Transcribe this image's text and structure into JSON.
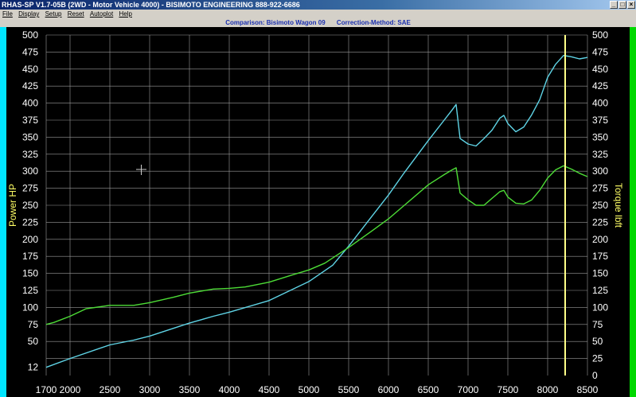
{
  "window": {
    "title": "RHAS-SP V1.7-05B  (2WD - Motor Vehicle 4000) - BISIMOTO ENGINEERING 888-922-6686",
    "minimize_glyph": "_",
    "restore_glyph": "□",
    "close_glyph": "×"
  },
  "menu": {
    "items": [
      "File",
      "Display",
      "Setup",
      "Reset",
      "Autoplot",
      "Help"
    ]
  },
  "comparison": {
    "left": "Comparison: Bisimoto Wagon 09",
    "right": "Correction-Method: SAE"
  },
  "colors": {
    "power_line": "#5fd4e6",
    "torque_line": "#4ddc36",
    "grid": "#9a9a9a",
    "cursor": "#ffff88",
    "left_stripe": "#00e5ff",
    "right_stripe": "#00d800"
  },
  "chart_data": {
    "type": "line",
    "xlabel": "",
    "x_ticks": [
      1700,
      2000,
      2500,
      3000,
      3500,
      4000,
      4500,
      5000,
      5500,
      6000,
      6500,
      7000,
      7500,
      8000,
      8500
    ],
    "xlim": [
      1700,
      8500
    ],
    "y_left_label": "Power HP",
    "y_right_label": "Torque lbft",
    "y_left_ticks": [
      12,
      50,
      75,
      100,
      125,
      150,
      175,
      200,
      225,
      250,
      275,
      300,
      325,
      350,
      375,
      400,
      425,
      450,
      475,
      500
    ],
    "y_right_ticks": [
      0,
      25,
      50,
      75,
      100,
      125,
      150,
      175,
      200,
      225,
      250,
      275,
      300,
      325,
      350,
      375,
      400,
      425,
      450,
      475,
      500
    ],
    "ylim": [
      0,
      500
    ],
    "cursor_rpm": 8220,
    "series": [
      {
        "axis": "left",
        "color": "#5fd4e6",
        "x": [
          1700,
          2000,
          2500,
          2800,
          3000,
          3500,
          3800,
          4000,
          4500,
          5000,
          5300,
          5500,
          5800,
          6000,
          6200,
          6500,
          6700,
          6800,
          6850,
          6900,
          7000,
          7100,
          7200,
          7300,
          7400,
          7450,
          7500,
          7600,
          7700,
          7800,
          7900,
          8000,
          8100,
          8200,
          8300,
          8400,
          8500
        ],
        "y": [
          12,
          25,
          45,
          52,
          58,
          77,
          87,
          93,
          110,
          138,
          162,
          190,
          235,
          265,
          298,
          345,
          375,
          390,
          398,
          348,
          340,
          337,
          348,
          360,
          378,
          382,
          370,
          358,
          365,
          383,
          405,
          438,
          457,
          470,
          468,
          465,
          467
        ]
      },
      {
        "axis": "right",
        "color": "#4ddc36",
        "x": [
          1700,
          1800,
          2000,
          2200,
          2500,
          2800,
          3000,
          3300,
          3500,
          3800,
          4000,
          4200,
          4500,
          4800,
          5000,
          5200,
          5500,
          5800,
          6000,
          6200,
          6500,
          6700,
          6800,
          6850,
          6900,
          7000,
          7100,
          7200,
          7300,
          7400,
          7450,
          7500,
          7600,
          7700,
          7800,
          7900,
          8000,
          8100,
          8200,
          8300,
          8400,
          8500
        ],
        "y": [
          75,
          78,
          87,
          98,
          103,
          103,
          107,
          115,
          121,
          127,
          128,
          130,
          137,
          148,
          155,
          165,
          188,
          213,
          230,
          250,
          280,
          295,
          302,
          305,
          268,
          258,
          250,
          250,
          260,
          270,
          272,
          262,
          253,
          252,
          258,
          272,
          290,
          302,
          308,
          303,
          297,
          292
        ]
      }
    ]
  }
}
